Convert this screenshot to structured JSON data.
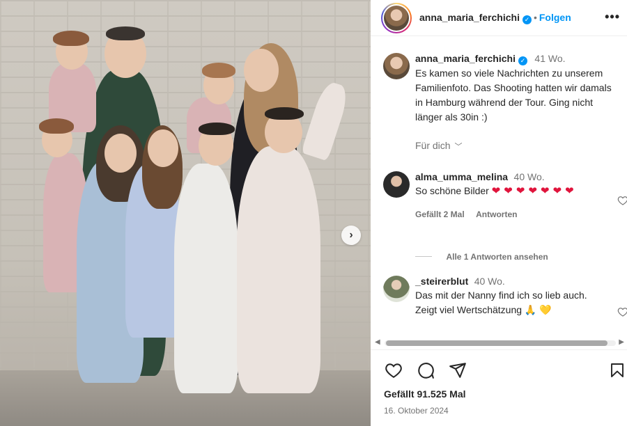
{
  "post": {
    "author": "anna_maria_ferchichi",
    "follow_label": "Folgen",
    "dot": "•",
    "more_icon": "more-horizontal-icon",
    "verified_icon": "verified-badge-icon"
  },
  "caption": {
    "author": "anna_maria_ferchichi",
    "time": "41 Wo.",
    "text": "Es kamen so viele Nachrichten zu unserem Familienfoto. Das Shooting hatten wir damals in Hamburg während der Tour. Ging nicht länger als 30in :)",
    "translation_label": "Für dich"
  },
  "comments": [
    {
      "author": "alma_umma_melina",
      "time": "40 Wo.",
      "text": "So schöne Bilder",
      "emoji": "❤❤❤❤❤❤❤",
      "likes_label": "Gefällt 2 Mal",
      "reply_label": "Antworten",
      "view_replies_label": "Alle 1 Antworten ansehen"
    },
    {
      "author": "_steirerblut",
      "time": "40 Wo.",
      "text": "Das mit der Nanny find ich so lieb auch. Zeigt viel Wertschätzung",
      "emoji": "🙏",
      "emoji2": "💛"
    }
  ],
  "footer": {
    "likes": "Gefällt 91.525 Mal",
    "date": "16. Oktober 2024"
  },
  "colors": {
    "accent": "#0095f6",
    "heart": "#e0143c"
  }
}
